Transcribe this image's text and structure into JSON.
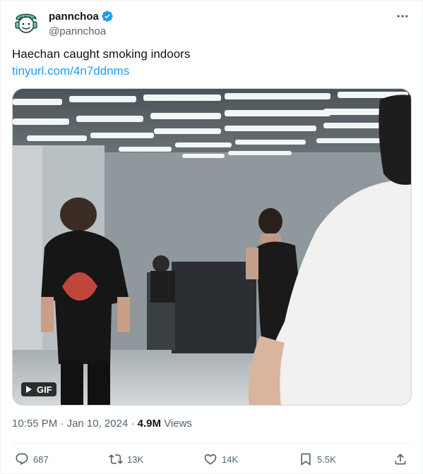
{
  "author": {
    "display_name": "pannchoa",
    "handle": "@pannchoa",
    "verified": true,
    "avatar_icon": "smiling-face-with-headphones-logo",
    "avatar_color": "#5ec7a0"
  },
  "tweet": {
    "text": "Haechan caught smoking indoors",
    "link": "tinyurl.com/4n7ddnms"
  },
  "media": {
    "type": "gif",
    "badge_label": "GIF",
    "badge_icon": "play-icon"
  },
  "meta": {
    "time": "10:55 PM",
    "separator": "·",
    "date": "Jan 10, 2024",
    "views_count": "4.9M",
    "views_label": "Views"
  },
  "actions": {
    "replies": "687",
    "retweets": "13K",
    "likes": "14K",
    "bookmarks": "5.5K"
  },
  "colors": {
    "link": "#1d9bf0",
    "secondary_text": "#536471",
    "verified_badge": "#1d9bf0"
  }
}
